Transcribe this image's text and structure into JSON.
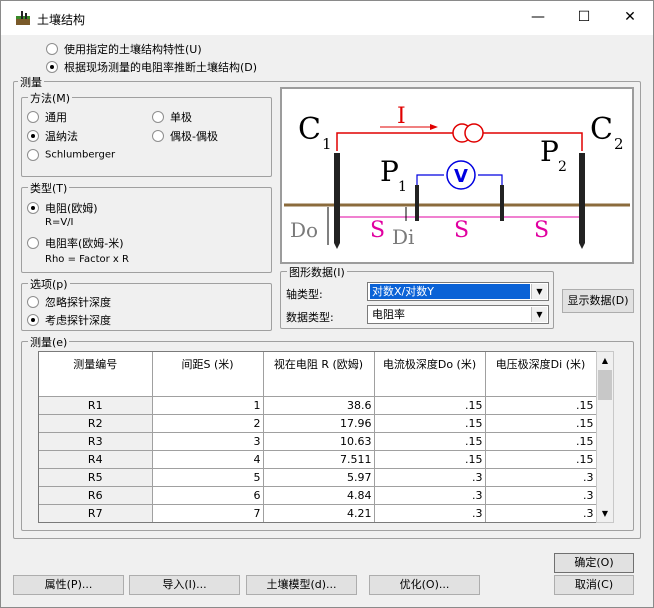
{
  "window": {
    "title": "土壤结构",
    "min": "—",
    "max": "☐",
    "close": "✕"
  },
  "mode": {
    "opt_specified": "使用指定的土壤结构特性(U)",
    "opt_measured": "根据现场测量的电阻率推断土壤结构(D)"
  },
  "measure_group": "测量",
  "method": {
    "title": "方法(M)",
    "general": "通用",
    "wenner": "温纳法",
    "schlumberger": "Schlumberger",
    "unipolar": "单极",
    "dipole": "偶极-偶极"
  },
  "type": {
    "title": "类型(T)",
    "resistance": "电阻(欧姆)",
    "resistance_note": "R=V/I",
    "resistivity": "电阻率(欧姆-米)",
    "resistivity_note": "Rho = Factor x R"
  },
  "options": {
    "title": "选项(p)",
    "ignore_depth": "忽略探针深度",
    "consider_depth": "考虑探针深度"
  },
  "diagram": {
    "c1": "C",
    "c1_sub": "1",
    "c2": "C",
    "c2_sub": "2",
    "p1": "P",
    "p1_sub": "1",
    "p2": "P",
    "p2_sub": "2",
    "current": "I",
    "voltmeter": "V",
    "do": "Do",
    "di": "Di",
    "s": "S"
  },
  "graph": {
    "title": "图形数据(I)",
    "axis_type_label": "轴类型:",
    "axis_type_value": "对数X/对数Y",
    "data_type_label": "数据类型:",
    "data_type_value": "电阻率",
    "show_data_button": "显示数据(D)"
  },
  "measurements": {
    "title": "测量(e)",
    "columns": [
      "测量编号",
      "间距S (米)",
      "视在电阻 R (欧姆)",
      "电流极深度Do (米)",
      "电压极深度Di (米)"
    ],
    "rows": [
      [
        "R1",
        "1",
        "38.6",
        ".15",
        ".15"
      ],
      [
        "R2",
        "2",
        "17.96",
        ".15",
        ".15"
      ],
      [
        "R3",
        "3",
        "10.63",
        ".15",
        ".15"
      ],
      [
        "R4",
        "4",
        "7.511",
        ".15",
        ".15"
      ],
      [
        "R5",
        "5",
        "5.97",
        ".3",
        ".3"
      ],
      [
        "R6",
        "6",
        "4.84",
        ".3",
        ".3"
      ],
      [
        "R7",
        "7",
        "4.21",
        ".3",
        ".3"
      ]
    ]
  },
  "buttons": {
    "ok": "确定(O)",
    "cancel": "取消(C)",
    "properties": "属性(P)...",
    "import": "导入(I)...",
    "soil_model": "土壤模型(d)...",
    "optimize": "优化(O)..."
  },
  "colors": {
    "circuit_red": "#e00000",
    "voltmeter_blue": "#0000e0",
    "spacing_magenta": "#e000a0",
    "ground_brown": "#8b6b3c",
    "selection_blue": "#0a62d6"
  }
}
